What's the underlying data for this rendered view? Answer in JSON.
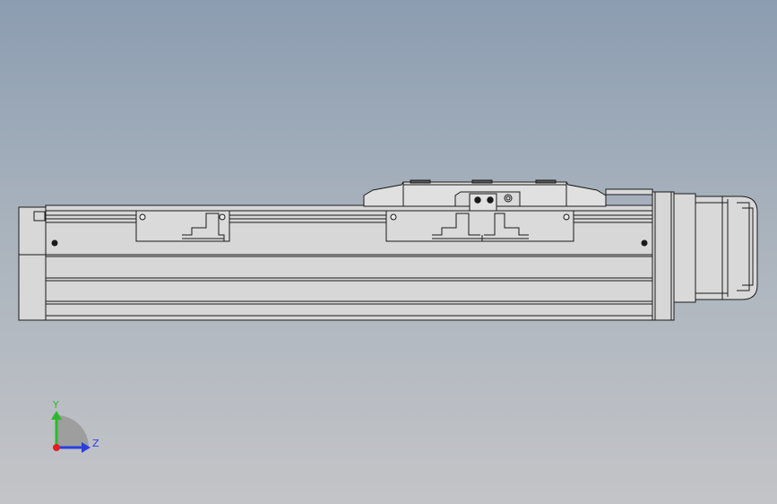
{
  "triad": {
    "y_label": "Y",
    "z_label": "Z",
    "colors": {
      "y_axis": "#2fb82f",
      "z_axis": "#2a3fe0",
      "x_axis": "#e02020"
    }
  },
  "colors": {
    "part_fill": "#d4d5d4",
    "part_fill_light": "#e3e4e3",
    "edge": "#1a1a1a"
  }
}
